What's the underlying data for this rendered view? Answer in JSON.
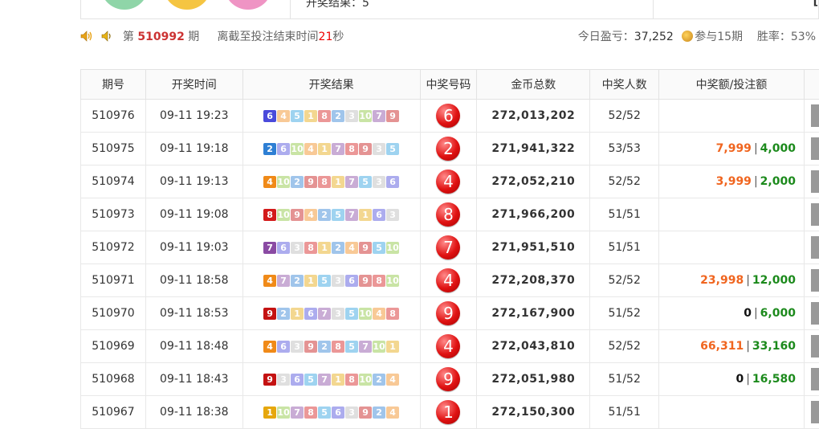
{
  "top": {
    "result_label": "开奖结果：",
    "result_value": "5",
    "mark": "["
  },
  "info": {
    "period_prefix": "第",
    "period": "510992",
    "period_suffix": "期",
    "countdown_prefix": "离截至投注结束时间",
    "countdown": "21",
    "countdown_suffix": "秒",
    "profit_label": "今日盈亏：",
    "profit_value": "37,252",
    "participated": "参与15期",
    "winrate_label": "胜率：",
    "winrate_value": "53%"
  },
  "table": {
    "headers": [
      "期号",
      "开奖时间",
      "开奖结果",
      "中奖号码",
      "金币总数",
      "中奖人数",
      "中奖额/投注额",
      ""
    ],
    "number_colors": {
      "1": "#e6a70c",
      "2": "#2e7fd4",
      "3": "#b9b9b9",
      "4": "#f08a18",
      "5": "#2aa0e0",
      "6": "#4a4adb",
      "7": "#8a4aa3",
      "8": "#d31a1a",
      "9": "#c41212",
      "10": "#8ac43a"
    },
    "rows": [
      {
        "period": "510976",
        "time": "09-11 19:23",
        "first": "6",
        "rest": [
          "4",
          "5",
          "1",
          "8",
          "2",
          "3",
          "10",
          "7",
          "9"
        ],
        "win": "6",
        "total": "272,013,202",
        "winners": "52/52",
        "award": "",
        "bet": ""
      },
      {
        "period": "510975",
        "time": "09-11 19:18",
        "first": "2",
        "rest": [
          "6",
          "10",
          "4",
          "1",
          "7",
          "8",
          "9",
          "3",
          "5"
        ],
        "win": "2",
        "total": "271,941,322",
        "winners": "53/53",
        "award": "7,999",
        "bet": "4,000",
        "award_color": "orange"
      },
      {
        "period": "510974",
        "time": "09-11 19:13",
        "first": "4",
        "rest": [
          "10",
          "2",
          "9",
          "8",
          "1",
          "7",
          "5",
          "3",
          "6"
        ],
        "win": "4",
        "total": "272,052,210",
        "winners": "52/52",
        "award": "3,999",
        "bet": "2,000",
        "award_color": "orange"
      },
      {
        "period": "510973",
        "time": "09-11 19:08",
        "first": "8",
        "rest": [
          "10",
          "9",
          "4",
          "2",
          "5",
          "7",
          "1",
          "6",
          "3"
        ],
        "win": "8",
        "total": "271,966,200",
        "winners": "51/51",
        "award": "",
        "bet": ""
      },
      {
        "period": "510972",
        "time": "09-11 19:03",
        "first": "7",
        "rest": [
          "6",
          "3",
          "8",
          "1",
          "2",
          "4",
          "9",
          "5",
          "10"
        ],
        "win": "7",
        "total": "271,951,510",
        "winners": "51/51",
        "award": "",
        "bet": ""
      },
      {
        "period": "510971",
        "time": "09-11 18:58",
        "first": "4",
        "rest": [
          "7",
          "2",
          "1",
          "5",
          "3",
          "6",
          "9",
          "8",
          "10"
        ],
        "win": "4",
        "total": "272,208,370",
        "winners": "52/52",
        "award": "23,998",
        "bet": "12,000",
        "award_color": "orange"
      },
      {
        "period": "510970",
        "time": "09-11 18:53",
        "first": "9",
        "rest": [
          "2",
          "1",
          "6",
          "7",
          "3",
          "5",
          "10",
          "4",
          "8"
        ],
        "win": "9",
        "total": "272,167,900",
        "winners": "51/52",
        "award": "0",
        "bet": "6,000",
        "award_color": "black"
      },
      {
        "period": "510969",
        "time": "09-11 18:48",
        "first": "4",
        "rest": [
          "6",
          "3",
          "9",
          "2",
          "8",
          "5",
          "7",
          "10",
          "1"
        ],
        "win": "4",
        "total": "272,043,810",
        "winners": "52/52",
        "award": "66,311",
        "bet": "33,160",
        "award_color": "orange"
      },
      {
        "period": "510968",
        "time": "09-11 18:43",
        "first": "9",
        "rest": [
          "3",
          "6",
          "5",
          "7",
          "1",
          "8",
          "10",
          "2",
          "4"
        ],
        "win": "9",
        "total": "272,051,980",
        "winners": "51/52",
        "award": "0",
        "bet": "16,580",
        "award_color": "black"
      },
      {
        "period": "510967",
        "time": "09-11 18:38",
        "first": "1",
        "rest": [
          "10",
          "7",
          "8",
          "5",
          "6",
          "3",
          "9",
          "2",
          "4"
        ],
        "win": "1",
        "total": "272,150,300",
        "winners": "51/51",
        "award": "",
        "bet": ""
      }
    ]
  }
}
